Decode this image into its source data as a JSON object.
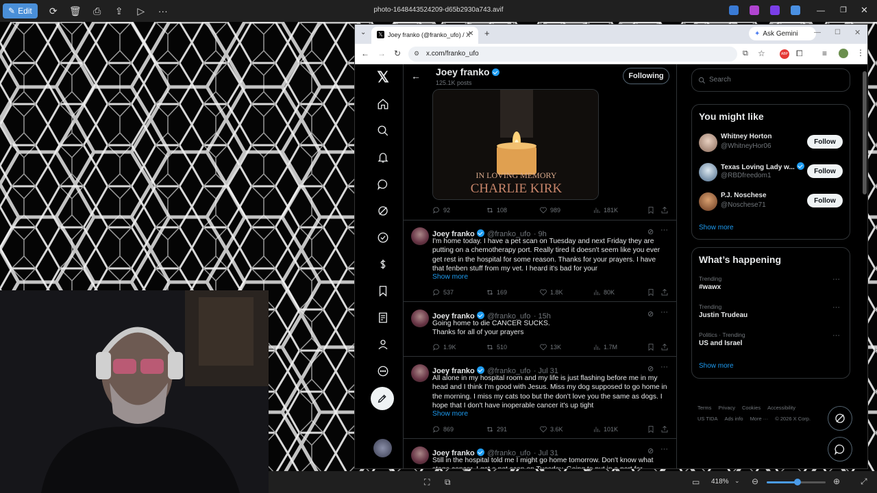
{
  "viewer": {
    "edit_label": "Edit",
    "file_name": "photo-1648443524209-d65b2930a743.avif",
    "zoom": "418%"
  },
  "browser": {
    "tab_title": "Joey franko (@franko_ufo) / X",
    "ask_gemini": "Ask Gemini",
    "url": "x.com/franko_ufo"
  },
  "profile": {
    "name": "Joey franko",
    "posts": "125.1K posts",
    "following_label": "Following"
  },
  "pinned_image": {
    "line1": "IN LOVING MEMORY",
    "line2": "CHARLIE KIRK"
  },
  "first_stats": {
    "replies": "92",
    "reposts": "108",
    "likes": "989",
    "views": "181K"
  },
  "tweets": [
    {
      "name": "Joey franko",
      "handle": "@franko_ufo",
      "time": "· 9h",
      "text": "I'm home today. I have a pet scan on Tuesday and next Friday they are putting on a chemotherapy port. Really tired it doesn't seem like you ever get rest in the hospital for some reason.  Thanks for your prayers.  I have that fenben stuff from my vet. I heard it's bad for your",
      "show_more": "Show more",
      "replies": "537",
      "reposts": "169",
      "likes": "1.8K",
      "views": "80K"
    },
    {
      "name": "Joey franko",
      "handle": "@franko_ufo",
      "time": "· 15h",
      "text": "Going home to die CANCER SUCKS.\nThanks for all of your prayers",
      "replies": "1.9K",
      "reposts": "510",
      "likes": "13K",
      "views": "1.7M"
    },
    {
      "name": "Joey franko",
      "handle": "@franko_ufo",
      "time": "· Jul 31",
      "text": "All alone in my hospital room and my life is just flashing before me in my head and I think I'm good with Jesus. Miss my dog supposed to go home in the morning. I miss my cats too but the don't love you the same as dogs. I hope that I don't have inoperable cancer it's up tight",
      "show_more": "Show more",
      "replies": "869",
      "reposts": "291",
      "likes": "3.6K",
      "views": "101K"
    },
    {
      "name": "Joey franko",
      "handle": "@franko_ufo",
      "time": "· Jul 31",
      "text": "Still in the hospital told me I might go home tomorrow. Don't know what stage cancer. I got a pet scan on Tuesday. Going to put in a port for"
    }
  ],
  "sidebar": {
    "search_placeholder": "Search",
    "you_might_like": "You might like",
    "suggestions": [
      {
        "name": "Whitney Horton",
        "handle": "@WhitneyHor06",
        "follow": "Follow",
        "verified": false
      },
      {
        "name": "Texas Loving Lady w...",
        "handle": "@RBDfreedom1",
        "follow": "Follow",
        "verified": true
      },
      {
        "name": "P.J. Noschese",
        "handle": "@Noschese71",
        "follow": "Follow",
        "verified": false
      }
    ],
    "show_more": "Show more",
    "whats_happening": "What’s happening",
    "trends": [
      {
        "context": "Trending",
        "topic": "#wawx"
      },
      {
        "context": "Trending",
        "topic": "Justin Trudeau"
      },
      {
        "context": "Politics · Trending",
        "topic": "US and Israel"
      }
    ],
    "show_more2": "Show more",
    "footer1": [
      "Terms",
      "Privacy",
      "Cookies",
      "Accessibility"
    ],
    "footer2": [
      "US TIDA",
      "Ads info",
      "More ···",
      "© 2026 X Corp."
    ]
  }
}
